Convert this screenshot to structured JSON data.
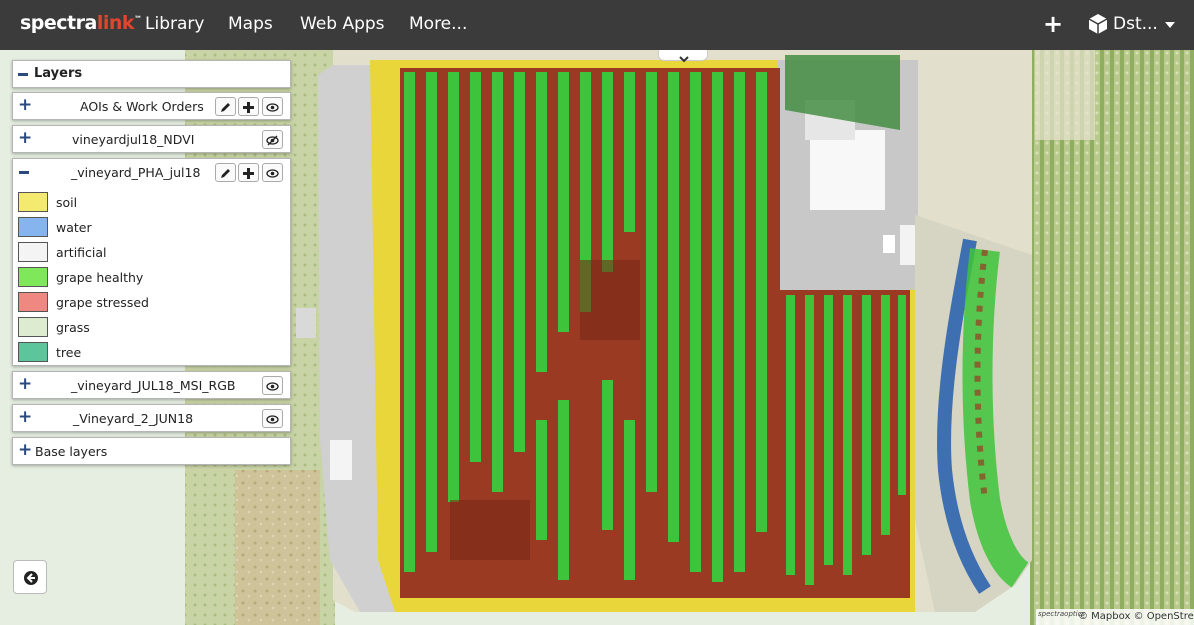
{
  "header": {
    "logo_main": "spectra",
    "logo_accent": "link",
    "logo_mark": "™",
    "nav": [
      "Library",
      "Maps",
      "Web Apps",
      "More..."
    ],
    "user_label": "Dst..."
  },
  "layers_panel": {
    "title": "Layers",
    "layers": [
      {
        "name": "AOIs & Work Orders",
        "expanded": false
      },
      {
        "name": "vineyardjul18_NDVI",
        "expanded": false
      },
      {
        "name": "_vineyard_PHA_jul18",
        "expanded": true
      },
      {
        "name": "_vineyard_JUL18_MSI_RGB",
        "expanded": false
      },
      {
        "name": "_Vineyard_2_JUN18",
        "expanded": false
      }
    ],
    "legend": [
      {
        "label": "soil",
        "color": "#f5ea70"
      },
      {
        "label": "water",
        "color": "#86b4ef"
      },
      {
        "label": "artificial",
        "color": "#f4f4f4"
      },
      {
        "label": "grape healthy",
        "color": "#7fe85a"
      },
      {
        "label": "grape stressed",
        "color": "#ee8880"
      },
      {
        "label": "grass",
        "color": "#ddebd0"
      },
      {
        "label": "tree",
        "color": "#5cc59b"
      }
    ],
    "base_layers_label": "Base layers"
  },
  "map": {
    "attribution_logo": "spectraoptics",
    "attribution": "© Mapbox © OpenStreet",
    "colors": {
      "healthy": "#3ec43a",
      "stressed": "#9a3a22",
      "soil": "#e9d63a",
      "artificial": "#dadada",
      "water": "#3e6fb0",
      "field": "#c9d6a3"
    }
  }
}
